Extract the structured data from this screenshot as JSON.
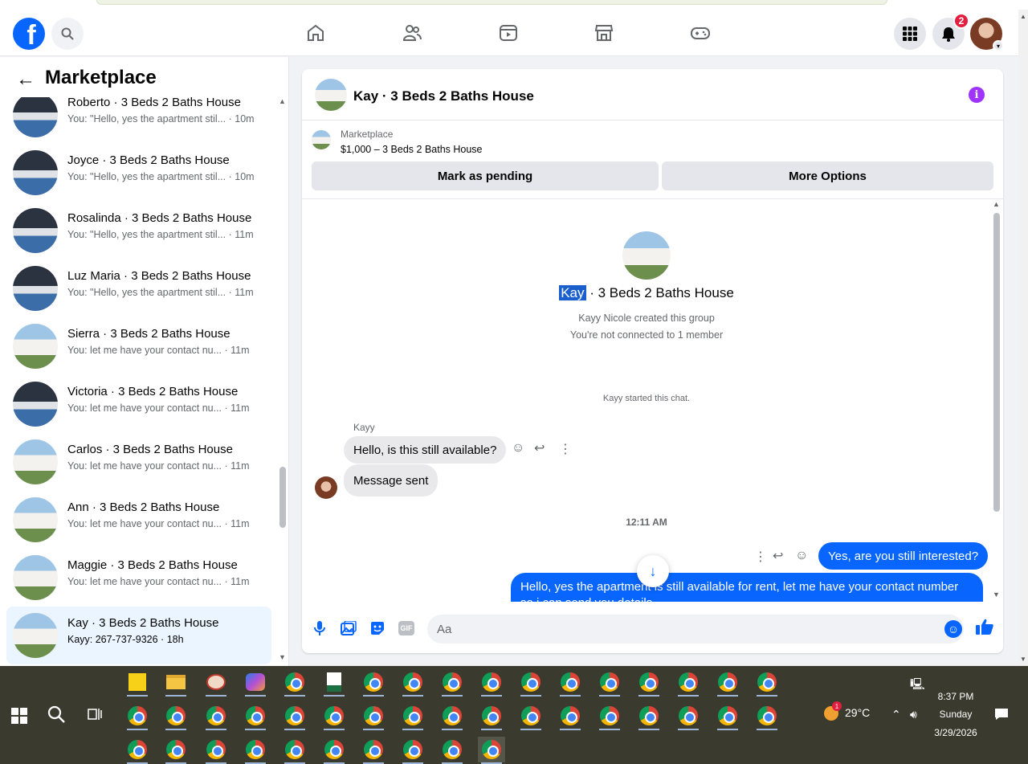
{
  "topnav": {
    "notification_count": "2"
  },
  "left": {
    "title": "Marketplace",
    "conversations": [
      {
        "name": "Roberto · 3 Beds 2 Baths House",
        "preview": "You: \"Hello, yes the apartment stil... · 10m",
        "thumb": "dark"
      },
      {
        "name": "Joyce · 3 Beds 2 Baths House",
        "preview": "You: \"Hello, yes the apartment stil... · 10m",
        "thumb": "dark"
      },
      {
        "name": "Rosalinda · 3 Beds 2 Baths House",
        "preview": "You: \"Hello, yes the apartment stil... · 11m",
        "thumb": "dark"
      },
      {
        "name": "Luz Maria · 3 Beds 2 Baths House",
        "preview": "You: \"Hello, yes the apartment stil... · 11m",
        "thumb": "dark"
      },
      {
        "name": "Sierra · 3 Beds 2 Baths House",
        "preview": "You: let me have your contact nu... · 11m",
        "thumb": "light"
      },
      {
        "name": "Victoria · 3 Beds 2 Baths House",
        "preview": "You: let me have your contact nu... · 11m",
        "thumb": "dark"
      },
      {
        "name": "Carlos · 3 Beds 2 Baths House",
        "preview": "You: let me have your contact nu... · 11m",
        "thumb": "light"
      },
      {
        "name": "Ann · 3 Beds 2 Baths House",
        "preview": "You: let me have your contact nu... · 11m",
        "thumb": "light"
      },
      {
        "name": "Maggie · 3 Beds 2 Baths House",
        "preview": "You: let me have your contact nu... · 11m",
        "thumb": "light"
      },
      {
        "name": "Kay · 3 Beds 2 Baths House",
        "preview": "Kayy: 267-737-9326 · 18h",
        "thumb": "light",
        "active": true
      }
    ]
  },
  "chat": {
    "title": "Kay · 3 Beds 2 Baths House",
    "listing_label": "Marketplace",
    "listing_price": "$1,000 – 3 Beds 2 Baths House",
    "mark_pending": "Mark as pending",
    "more_options": "More Options",
    "group_name_highlight": "Kay",
    "group_name_rest": " · 3 Beds 2 Baths House",
    "created_by": "Kayy Nicole created this group",
    "not_connected": "You're not connected to 1 member",
    "started_chat": "Kayy started this chat.",
    "sender": "Kayy",
    "msg_in_1": "Hello, is this still available?",
    "msg_in_2": "Message sent",
    "time_sep": "12:11 AM",
    "msg_out_1": "Yes, are you still interested?",
    "msg_out_2": "Hello, yes the apartment is still available for rent, let me have your contact number so i can send you details",
    "composer_placeholder": "Aa"
  },
  "taskbar": {
    "temperature": "29°C",
    "weather_badge": "1",
    "time": "8:37 PM",
    "day": "Sunday",
    "date": "3/29/2026"
  }
}
